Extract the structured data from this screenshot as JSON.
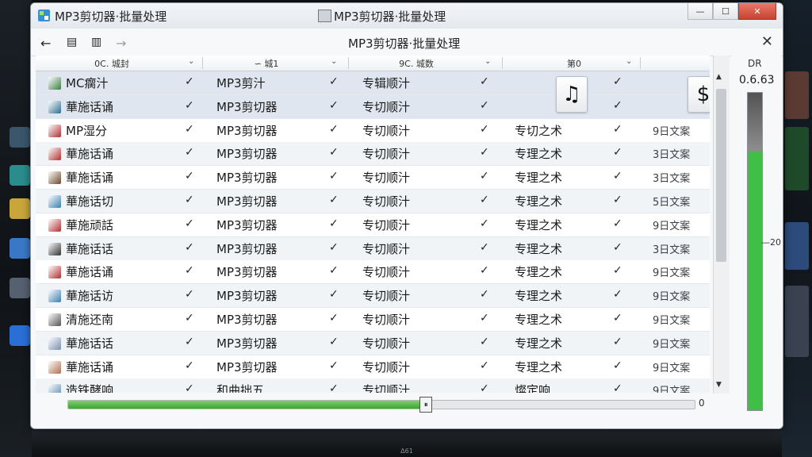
{
  "window": {
    "title": "MP3剪切器·批量处理",
    "center_title": "MP3剪切器·批量处理",
    "nav_title": "MP3剪切器·批量处理"
  },
  "columns": [
    "0C. 城封",
    "∽ 城1",
    "9C. 城数",
    "第0",
    ""
  ],
  "rows": [
    {
      "name": "MC瘸汁",
      "artist": "MP3剪汁",
      "type": "专辑顺汁",
      "album": "",
      "date": "",
      "icon": "music-file-icon",
      "icon_color": "#3a7d44"
    },
    {
      "name": "華施话诵",
      "artist": "MP3剪切器",
      "type": "专切顺汁",
      "album": "",
      "date": "",
      "icon": "image-file-icon",
      "icon_color": "#2f6f8f"
    },
    {
      "name": "MP湿分",
      "artist": "MP3剪切器",
      "type": "专切顺汁",
      "album": "专切之术",
      "date": "9日文案",
      "icon": "music-file-icon",
      "icon_color": "#b03030"
    },
    {
      "name": "華施话诵",
      "artist": "MP3剪切器",
      "type": "专切顺汁",
      "album": "专理之术",
      "date": "3日文案",
      "icon": "music-file-icon",
      "icon_color": "#b03030"
    },
    {
      "name": "華施话诵",
      "artist": "MP3剪切器",
      "type": "专切顺汁",
      "album": "专理之术",
      "date": "3日文案",
      "icon": "music-file-icon",
      "icon_color": "#6b4a2a"
    },
    {
      "name": "華施话切",
      "artist": "MP3剪切器",
      "type": "专切顺汁",
      "album": "专理之术",
      "date": "5日文案",
      "icon": "chart-file-icon",
      "icon_color": "#3a7fb0"
    },
    {
      "name": "華施顽話",
      "artist": "MP3剪切器",
      "type": "专切顺汁",
      "album": "专理之术",
      "date": "9日文案",
      "icon": "music-file-icon",
      "icon_color": "#b03030"
    },
    {
      "name": "華施话话",
      "artist": "MP3剪切器",
      "type": "专切顺汁",
      "album": "专理之术",
      "date": "3日文案",
      "icon": "treble-clef-icon",
      "icon_color": "#333333"
    },
    {
      "name": "華施话诵",
      "artist": "MP3剪切器",
      "type": "专切顺汁",
      "album": "专理之术",
      "date": "9日文案",
      "icon": "music-file-icon",
      "icon_color": "#b03030"
    },
    {
      "name": "華施话访",
      "artist": "MP3剪切器",
      "type": "专切顺汁",
      "album": "专理之术",
      "date": "9日文案",
      "icon": "chart-file-icon",
      "icon_color": "#3a7fb0"
    },
    {
      "name": "清施还南",
      "artist": "MP3剪切器",
      "type": "专切顺汁",
      "album": "专理之术",
      "date": "9日文案",
      "icon": "music-file-icon",
      "icon_color": "#555555"
    },
    {
      "name": "華施话话",
      "artist": "MP3剪切器",
      "type": "专切顺汁",
      "album": "专理之术",
      "date": "9日文案",
      "icon": "disc-file-icon",
      "icon_color": "#7a8fb0"
    },
    {
      "name": "華施话诵",
      "artist": "MP3剪切器",
      "type": "专切顺汁",
      "album": "专理之术",
      "date": "9日文案",
      "icon": "triangle-file-icon",
      "icon_color": "#b07050"
    },
    {
      "name": "造铁酵响",
      "artist": "和曲拙五",
      "type": "专切顺汁",
      "album": "燦定响",
      "date": "9日文案",
      "icon": "document-file-icon",
      "icon_color": "#5a8ab0"
    }
  ],
  "tiles": {
    "note": "♫",
    "dollar": "$"
  },
  "progress": {
    "value": "0",
    "fraction": 0.57
  },
  "meter": {
    "label": "DR",
    "value": "0.6.63",
    "tick": "20",
    "level": 0.82
  },
  "footer_mark": "Δ61"
}
